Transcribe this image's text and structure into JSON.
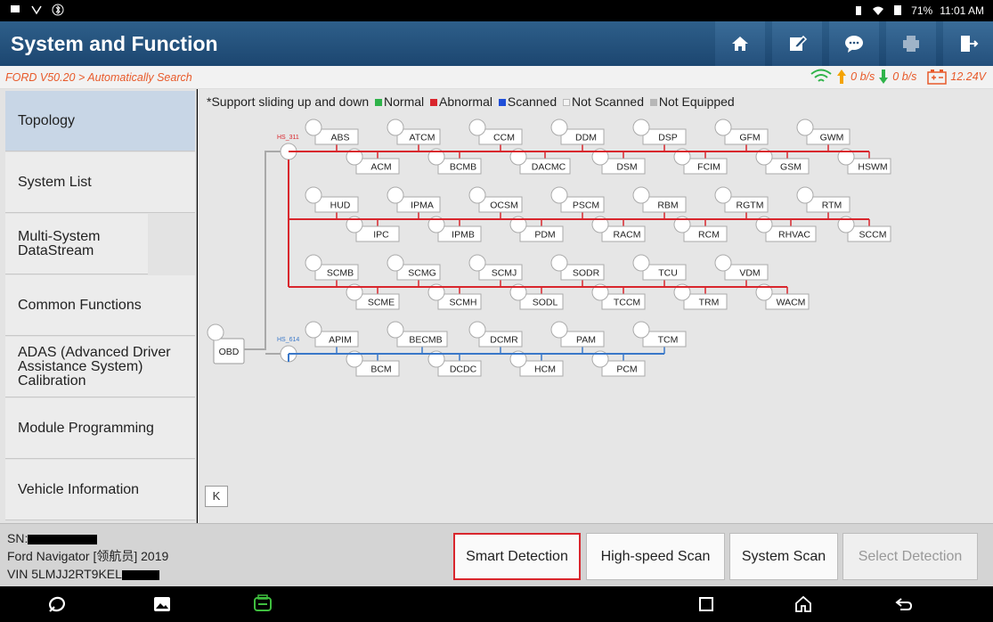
{
  "status_bar": {
    "left_icons": [
      "notification-icon",
      "vci-icon",
      "bluetooth-icon"
    ],
    "right_icons": [
      "vibrate-icon",
      "wifi-icon"
    ],
    "battery": "71%",
    "time": "11:01 AM"
  },
  "header": {
    "title": "System and Function",
    "toolbar_icons": [
      "home-icon",
      "edit-icon",
      "chat-icon",
      "print-icon",
      "exit-icon"
    ]
  },
  "breadcrumb": "FORD V50.20 > Automatically Search",
  "net": {
    "up": "0 b/s",
    "down": "0 b/s",
    "voltage": "12.24V"
  },
  "sidebar": {
    "items": [
      {
        "label": "Topology"
      },
      {
        "label": "System List"
      },
      {
        "label": "Multi-System DataStream"
      },
      {
        "label": "Common Functions"
      },
      {
        "label": "ADAS (Advanced Driver Assistance System) Calibration"
      },
      {
        "label": "Module Programming"
      },
      {
        "label": "Vehicle Information"
      }
    ]
  },
  "legend": {
    "prefix": "*Support sliding up and down",
    "normal": "Normal",
    "abnormal": "Abnormal",
    "scanned": "Scanned",
    "not_scanned": "Not Scanned",
    "not_equipped": "Not Equipped"
  },
  "colors": {
    "normal": "#2fb34a",
    "abnormal": "#d9262d",
    "scanned": "#1f4ed8",
    "not_scanned": "#f4f4f4",
    "not_equipped": "#b7b7b7",
    "hs311_bus": "#d9262d",
    "hs614_bus": "#3a78c9"
  },
  "topology": {
    "obd_label": "OBD",
    "bus_hs311": "HS_311",
    "bus_hs614": "HS_614",
    "hs311_rows": [
      {
        "side": "top",
        "modules": [
          "ABS",
          "ATCM",
          "CCM",
          "DDM",
          "DSP",
          "GFM",
          "GWM"
        ]
      },
      {
        "side": "bottom",
        "modules": [
          "ACM",
          "BCMB",
          "DACMC",
          "DSM",
          "FCIM",
          "GSM",
          "HSWM"
        ]
      },
      {
        "side": "top",
        "modules": [
          "HUD",
          "IPMA",
          "OCSM",
          "PSCM",
          "RBM",
          "RGTM",
          "RTM"
        ]
      },
      {
        "side": "bottom",
        "modules": [
          "IPC",
          "IPMB",
          "PDM",
          "RACM",
          "RCM",
          "RHVAC",
          "SCCM"
        ]
      },
      {
        "side": "top",
        "modules": [
          "SCMB",
          "SCMG",
          "SCMJ",
          "SODR",
          "TCU",
          "VDM"
        ]
      },
      {
        "side": "bottom",
        "modules": [
          "SCME",
          "SCMH",
          "SODL",
          "TCCM",
          "TRM",
          "WACM"
        ]
      }
    ],
    "hs614_rows": [
      {
        "side": "top",
        "modules": [
          "APIM",
          "BECMB",
          "DCMR",
          "PAM",
          "TCM"
        ]
      },
      {
        "side": "bottom",
        "modules": [
          "BCM",
          "DCDC",
          "HCM",
          "PCM"
        ]
      }
    ]
  },
  "collapse_label": "K",
  "vehicle": {
    "sn_label": "SN:",
    "model": "Ford Navigator [领航员] 2019",
    "vin_prefix": "VIN 5LMJJ2RT9KEL"
  },
  "actions": {
    "smart_detection": "Smart Detection",
    "high_speed_scan": "High-speed Scan",
    "system_scan": "System Scan",
    "select_detection": "Select Detection"
  },
  "nav_icons": [
    "browser-icon",
    "gallery-icon",
    "vci-app-icon",
    "recent-apps-icon",
    "home-nav-icon",
    "back-icon"
  ]
}
